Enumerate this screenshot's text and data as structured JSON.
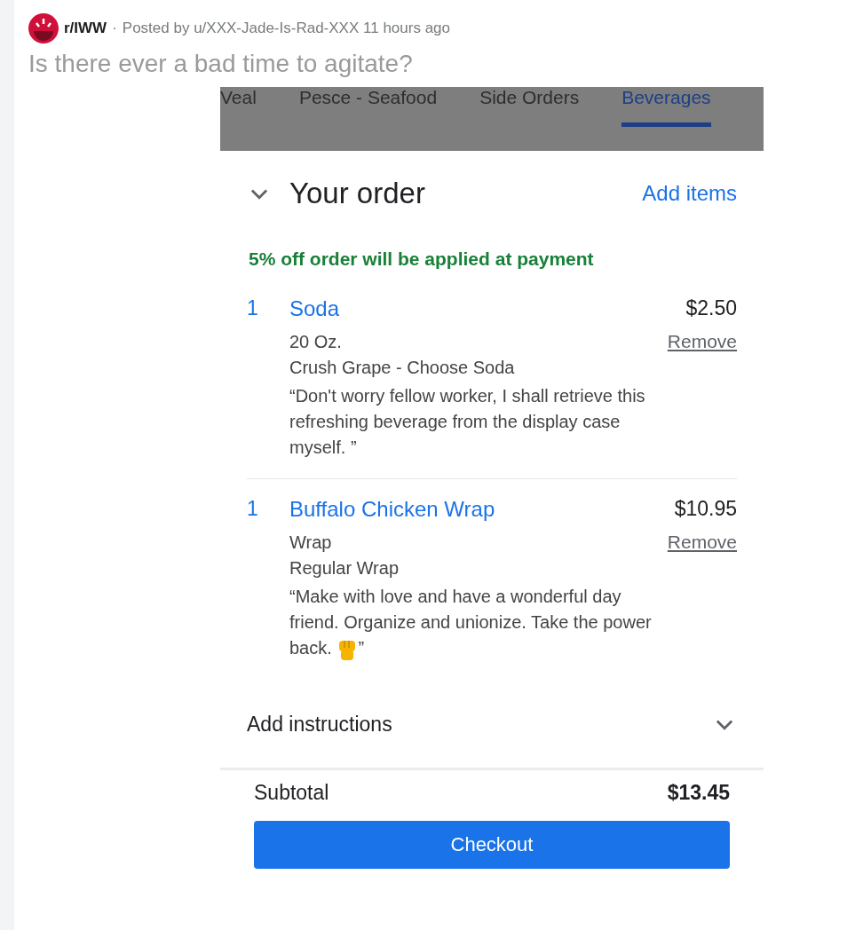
{
  "post": {
    "subreddit": "r/IWW",
    "separator": "·",
    "byline": "Posted by u/XXX-Jade-Is-Rad-XXX 11 hours ago",
    "title": "Is there ever a bad time to agitate?"
  },
  "tabs": [
    {
      "label": "Veal",
      "selected": false
    },
    {
      "label": "Pesce - Seafood",
      "selected": false
    },
    {
      "label": "Side Orders",
      "selected": false
    },
    {
      "label": "Beverages",
      "selected": true
    }
  ],
  "order": {
    "title": "Your order",
    "add_items": "Add items",
    "discount": "5% off order will be applied at payment",
    "items": [
      {
        "qty": "1",
        "name": "Soda",
        "price": "$2.50",
        "remove": "Remove",
        "options": [
          "20 Oz.",
          "Crush Grape - Choose Soda"
        ],
        "note": "“Don't worry fellow worker, I shall retrieve this refreshing beverage from the display case myself. ”"
      },
      {
        "qty": "1",
        "name": "Buffalo Chicken Wrap",
        "price": "$10.95",
        "remove": "Remove",
        "options": [
          "Wrap",
          "Regular Wrap"
        ],
        "note": "“Make with love and have a wonderful day friend. Organize and unionize. Take the power back.",
        "note_end": "”"
      }
    ],
    "instructions": "Add instructions",
    "subtotal_label": "Subtotal",
    "subtotal": "$13.45",
    "checkout": "Checkout"
  }
}
